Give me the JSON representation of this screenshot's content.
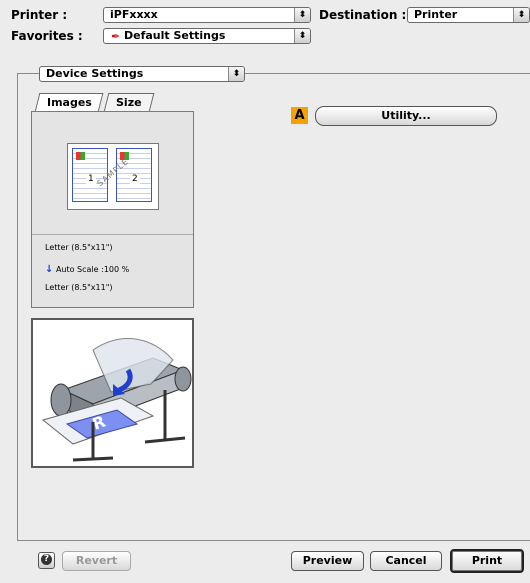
{
  "printer": {
    "label": "Printer :",
    "value": "iPFxxxx"
  },
  "destination": {
    "label": "Destination :",
    "value": "Printer"
  },
  "favorites": {
    "label": "Favorites :",
    "value": "Default Settings"
  },
  "panel_select": {
    "value": "Device Settings"
  },
  "tabs": [
    {
      "label": "Images"
    },
    {
      "label": "Size"
    }
  ],
  "preview": {
    "page1": "1",
    "page2": "2",
    "watermark": "SAMPLE",
    "paper_top": "Letter (8.5\"x11\")",
    "auto_scale": "Auto Scale :100 %",
    "paper_bottom": "Letter (8.5\"x11\")"
  },
  "utility": {
    "marker": "A",
    "label": "Utility..."
  },
  "footer": {
    "help_glyph": "?",
    "revert": "Revert",
    "preview": "Preview",
    "cancel": "Cancel",
    "print": "Print"
  },
  "colors": {
    "marker_bg": "#f5a200",
    "arrow_blue": "#1f3fd0"
  }
}
